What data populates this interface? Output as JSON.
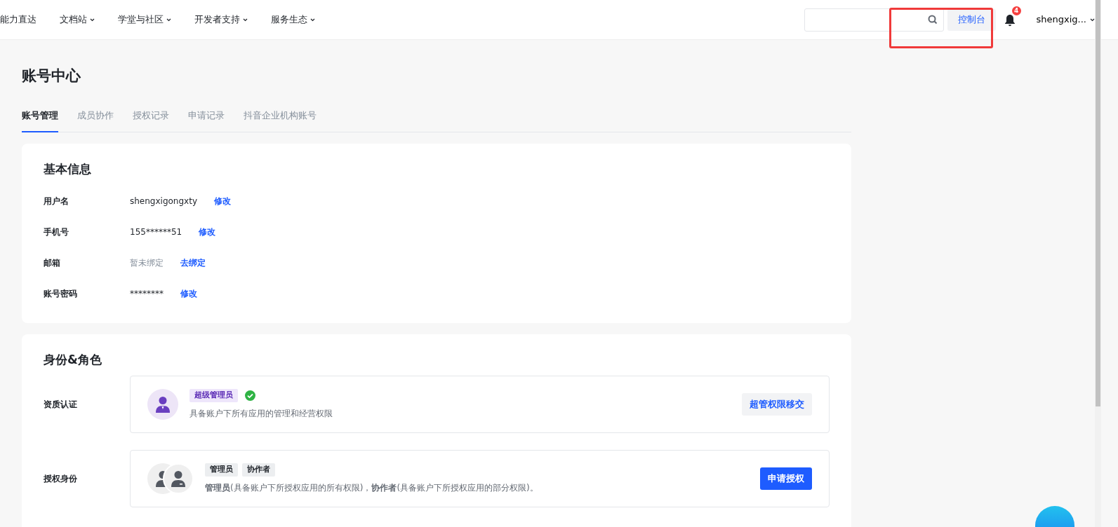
{
  "nav": {
    "items": [
      {
        "label": "能力直达",
        "dropdown": false
      },
      {
        "label": "文档站",
        "dropdown": true
      },
      {
        "label": "学堂与社区",
        "dropdown": true
      },
      {
        "label": "开发者支持",
        "dropdown": true
      },
      {
        "label": "服务生态",
        "dropdown": true
      }
    ],
    "console_button": "控制台",
    "notification_count": "4",
    "user": "shengxig..."
  },
  "page_title": "账号中心",
  "tabs": [
    {
      "label": "账号管理",
      "selected": true
    },
    {
      "label": "成员协作",
      "selected": false
    },
    {
      "label": "授权记录",
      "selected": false
    },
    {
      "label": "申请记录",
      "selected": false
    },
    {
      "label": "抖音企业机构账号",
      "selected": false
    }
  ],
  "basic_info": {
    "title": "基本信息",
    "fields": [
      {
        "label": "用户名",
        "value": "shengxigongxty",
        "action": "修改",
        "muted": false
      },
      {
        "label": "手机号",
        "value": "155******51",
        "action": "修改",
        "muted": false
      },
      {
        "label": "邮箱",
        "value": "暂未绑定",
        "action": "去绑定",
        "muted": true
      },
      {
        "label": "账号密码",
        "value": "********",
        "action": "修改",
        "muted": false
      }
    ]
  },
  "roles": {
    "title": "身份&角色",
    "rows": [
      {
        "kind": "super",
        "label": "资质认证",
        "tags": [
          "超级管理员"
        ],
        "verified": true,
        "description": "具备账户下所有应用的管理和经营权限",
        "button": "超管权限移交",
        "primary": false
      },
      {
        "kind": "auth",
        "label": "授权身份",
        "tags": [
          "管理员",
          "协作者"
        ],
        "verified": false,
        "description": "**管理员**(具备账户下所授权应用的所有权限)，**协作者**(具备账户下所授权应用的部分权限)。",
        "button": "申请授权",
        "primary": true
      }
    ]
  }
}
